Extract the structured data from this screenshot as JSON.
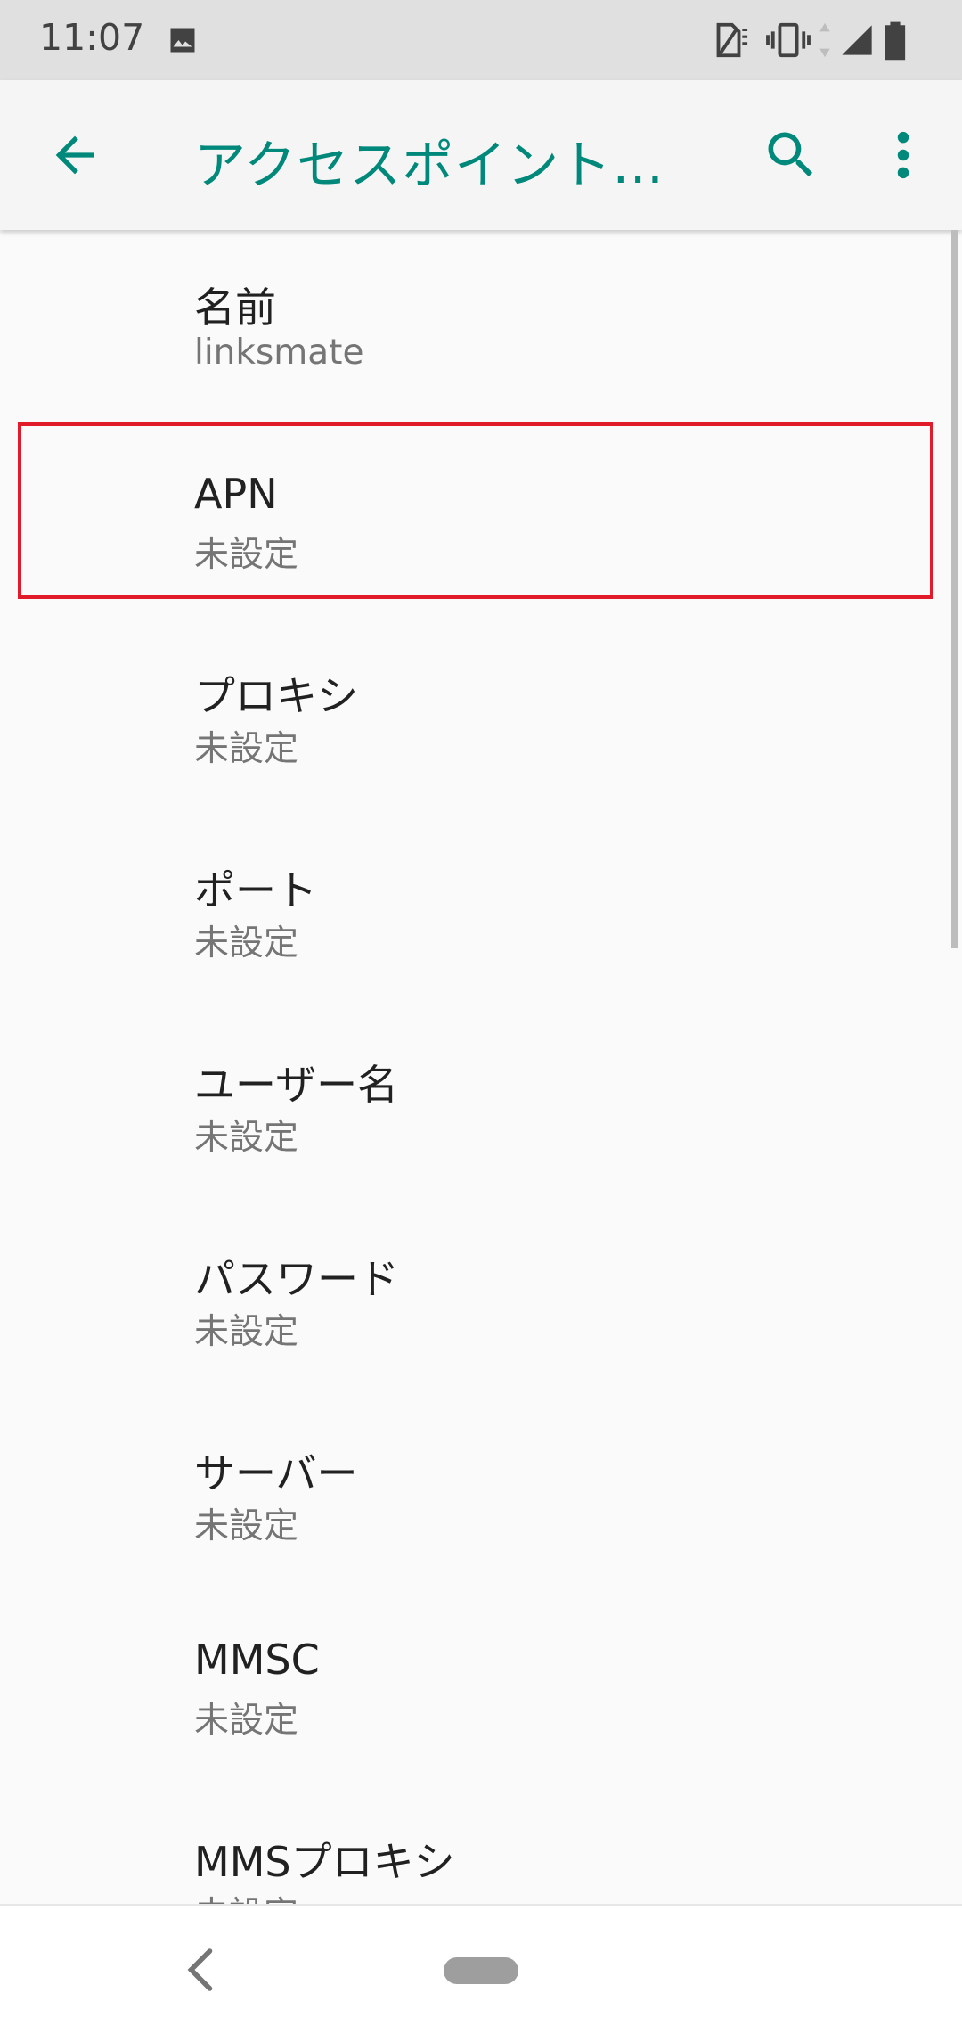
{
  "status_bar": {
    "time": "11:07",
    "icons": [
      "image-icon",
      "no-sim-icon",
      "vibrate-icon",
      "data-arrows-icon",
      "signal-icon",
      "battery-icon"
    ]
  },
  "app_bar": {
    "title": "アクセスポイント…",
    "back_icon": "arrow-back-icon",
    "search_icon": "search-icon",
    "more_icon": "more-vert-icon",
    "accent_color": "#00897b"
  },
  "settings": {
    "items": [
      {
        "title": "名前",
        "summary": "linksmate"
      },
      {
        "title": "APN",
        "summary": "未設定"
      },
      {
        "title": "プロキシ",
        "summary": "未設定"
      },
      {
        "title": "ポート",
        "summary": "未設定"
      },
      {
        "title": "ユーザー名",
        "summary": "未設定"
      },
      {
        "title": "パスワード",
        "summary": "未設定"
      },
      {
        "title": "サーバー",
        "summary": "未設定"
      },
      {
        "title": "MMSC",
        "summary": "未設定"
      },
      {
        "title": "MMSプロキシ",
        "summary": "未設定"
      }
    ],
    "highlight_color": "#e21b2a"
  },
  "nav_bar": {
    "back_icon": "chevron-left-icon",
    "home_icon": "home-pill-icon"
  }
}
